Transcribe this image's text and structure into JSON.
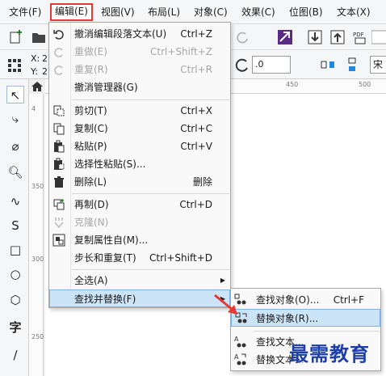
{
  "menubar": {
    "items": [
      "文件(F)",
      "编辑(E)",
      "视图(V)",
      "布局(L)",
      "对象(C)",
      "效果(C)",
      "位图(B)",
      "文本(X)"
    ]
  },
  "toolbar2": {
    "x_label": "X:",
    "y_label": "Y:",
    "x_value": "2",
    "y_value": "2",
    "angle_value": ".0",
    "font_partial": "宋"
  },
  "rulers": {
    "h_450": "450",
    "h_500": "500",
    "v_4": "4",
    "v_350": "350",
    "v_300": "300",
    "v_250": "250"
  },
  "edit_menu": {
    "items": [
      {
        "label": "撤消编辑段落文本(U)",
        "key": "Ctrl+Z",
        "icon": "undo-icon",
        "disabled": false
      },
      {
        "label": "重做(E)",
        "key": "Ctrl+Shift+Z",
        "icon": "redo-icon",
        "disabled": true
      },
      {
        "label": "重复(R)",
        "key": "Ctrl+R",
        "icon": "repeat-icon",
        "disabled": true
      },
      {
        "label": "撤消管理器(G)",
        "key": "",
        "icon": "",
        "disabled": false
      },
      {
        "label": "剪切(T)",
        "key": "Ctrl+X",
        "icon": "cut-icon",
        "disabled": false
      },
      {
        "label": "复制(C)",
        "key": "Ctrl+C",
        "icon": "copy-icon",
        "disabled": false
      },
      {
        "label": "粘贴(P)",
        "key": "Ctrl+V",
        "icon": "paste-icon",
        "disabled": false
      },
      {
        "label": "选择性粘贴(S)...",
        "key": "",
        "icon": "paste-special-icon",
        "disabled": false
      },
      {
        "label": "删除(L)",
        "key": "删除",
        "icon": "trash-icon",
        "disabled": false
      },
      {
        "label": "再制(D)",
        "key": "Ctrl+D",
        "icon": "duplicate-icon",
        "disabled": false
      },
      {
        "label": "克隆(N)",
        "key": "",
        "icon": "clone-icon",
        "disabled": true
      },
      {
        "label": "复制属性自(M)...",
        "key": "",
        "icon": "copy-properties-icon",
        "disabled": false
      },
      {
        "label": "步长和重复(T)",
        "key": "Ctrl+Shift+D",
        "icon": "",
        "disabled": false
      },
      {
        "label": "全选(A)",
        "key": "",
        "icon": "",
        "disabled": false
      },
      {
        "label": "查找并替换(F)",
        "key": "",
        "icon": "",
        "disabled": false
      }
    ]
  },
  "submenu": {
    "items": [
      {
        "label": "查找对象(O)...",
        "key": "Ctrl+F"
      },
      {
        "label": "替换对象(R)...",
        "key": ""
      },
      {
        "label": "查找文本...",
        "key": ""
      },
      {
        "label": "替换文本...",
        "key": ""
      }
    ]
  },
  "watermark": "最需教育",
  "colors": {
    "highlight_bg": "#cce4f7",
    "highlight_border": "#7eb4ea",
    "red_frame": "#e53935",
    "watermark": "#1f3fa8"
  }
}
